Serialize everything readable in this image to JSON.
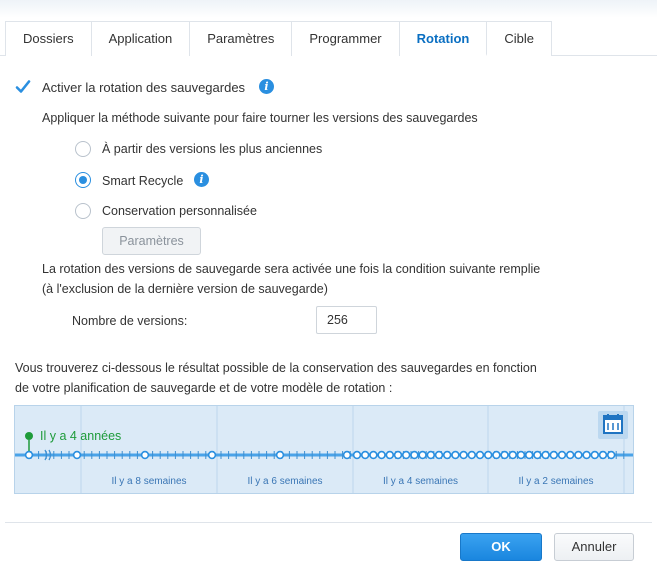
{
  "tabs": [
    {
      "label": "Dossiers",
      "active": false
    },
    {
      "label": "Application",
      "active": false
    },
    {
      "label": "Paramètres",
      "active": false
    },
    {
      "label": "Programmer",
      "active": false
    },
    {
      "label": "Rotation",
      "active": true
    },
    {
      "label": "Cible",
      "active": false
    }
  ],
  "rotation": {
    "enable_label": "Activer la rotation des sauvegardes",
    "enable_checked": true,
    "method_intro": "Appliquer la méthode suivante pour faire tourner les versions des sauvegardes",
    "options": [
      {
        "label": "À partir des versions les plus anciennes",
        "checked": false
      },
      {
        "label": "Smart Recycle",
        "checked": true
      },
      {
        "label": "Conservation personnalisée",
        "checked": false
      }
    ],
    "params_button": "Paramètres",
    "condition_line1": "La rotation des versions de sauvegarde sera activée une fois la condition suivante remplie",
    "condition_line2": "(à l'exclusion de la dernière version de sauvegarde)",
    "versions_label": "Nombre de versions:",
    "versions_value": "256",
    "result_line1": "Vous trouverez ci-dessous le résultat possible de la conservation des sauvegardes en fonction",
    "result_line2": "de votre planification de sauvegarde et de votre modèle de rotation :"
  },
  "timeline": {
    "marker_label": "Il y a 4 années",
    "period_labels": [
      "Il y a 8 semaines",
      "Il y a 6 semaines",
      "Il y a 4 semaines",
      "Il y a 2 semaines"
    ]
  },
  "footer": {
    "ok_label": "OK",
    "cancel_label": "Annuler"
  },
  "colors": {
    "accent": "#2a8fe0",
    "active_tab": "#0a6fc2",
    "timeline_marker": "#1e9b3a",
    "timeline_bg": "#dbeaf7"
  }
}
